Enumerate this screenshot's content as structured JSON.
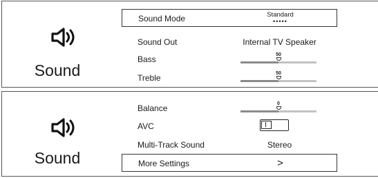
{
  "panels": [
    {
      "title": "Sound",
      "icon": "speaker-icon",
      "rows": [
        {
          "label": "Sound Mode",
          "value": "Standard",
          "kind": "selector",
          "dots": "•••••"
        },
        {
          "label": "Sound Out",
          "value": "Internal TV Speaker",
          "kind": "text"
        },
        {
          "label": "Bass",
          "value": "50",
          "kind": "slider",
          "level": 0.5
        },
        {
          "label": "Treble",
          "value": "50",
          "kind": "slider",
          "level": 0.5
        }
      ]
    },
    {
      "title": "Sound",
      "icon": "speaker-icon",
      "rows": [
        {
          "label": "Balance",
          "value": "0",
          "kind": "slider",
          "level": 0.5
        },
        {
          "label": "AVC",
          "value": "",
          "kind": "toggle",
          "state": "off"
        },
        {
          "label": "Multi-Track Sound",
          "value": "Stereo",
          "kind": "text"
        },
        {
          "label": "More Settings",
          "value": ">",
          "kind": "submenu"
        }
      ]
    }
  ],
  "colors": {
    "border": "#333333",
    "slider_fill": "#8a8a8a",
    "slider_track": "#c2c2c2",
    "text": "#1a1a1a"
  }
}
